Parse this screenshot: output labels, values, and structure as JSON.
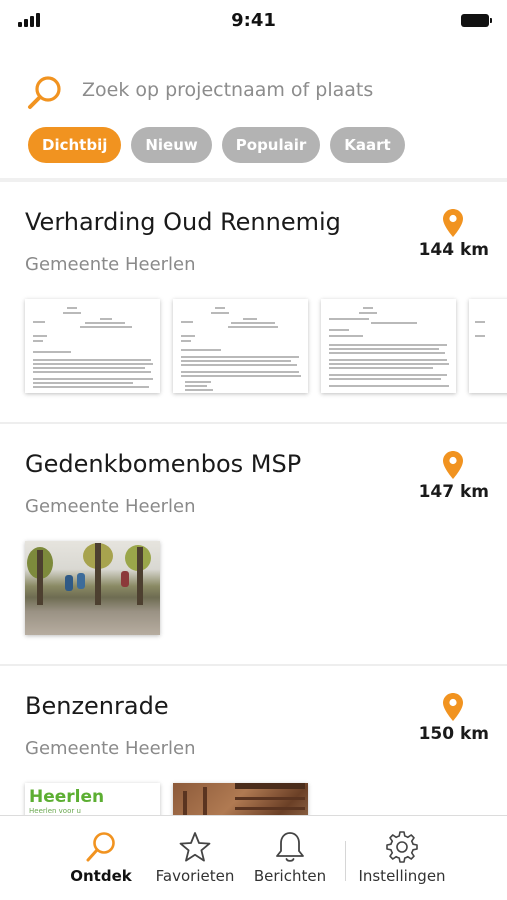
{
  "status_bar": {
    "time": "9:41"
  },
  "search": {
    "placeholder": "Zoek op projectnaam of plaats"
  },
  "filters": [
    {
      "label": "Dichtbij",
      "active": true
    },
    {
      "label": "Nieuw",
      "active": false
    },
    {
      "label": "Populair",
      "active": false
    },
    {
      "label": "Kaart",
      "active": false
    }
  ],
  "projects": [
    {
      "title": "Verharding Oud Rennemig",
      "municipality": "Gemeente Heerlen",
      "distance": "144 km",
      "thumbnails": [
        "document",
        "document",
        "document",
        "document"
      ]
    },
    {
      "title": "Gedenkbomenbos MSP",
      "municipality": "Gemeente Heerlen",
      "distance": "147 km",
      "thumbnails": [
        "photo"
      ]
    },
    {
      "title": "Benzenrade",
      "municipality": "Gemeente Heerlen",
      "distance": "150 km",
      "thumbnails": [
        "logo",
        "photo"
      ],
      "logo_text": "Heerlen",
      "logo_tagline": "Heerlen voor u"
    }
  ],
  "tabs": [
    {
      "label": "Ontdek",
      "icon": "search-icon",
      "active": true
    },
    {
      "label": "Favorieten",
      "icon": "star-icon",
      "active": false
    },
    {
      "label": "Berichten",
      "icon": "bell-icon",
      "active": false
    },
    {
      "label": "Instellingen",
      "icon": "gear-icon",
      "active": false
    }
  ],
  "colors": {
    "accent": "#f19320",
    "chip_inactive": "#b3b3b3",
    "muted_text": "#8a8a8a"
  }
}
